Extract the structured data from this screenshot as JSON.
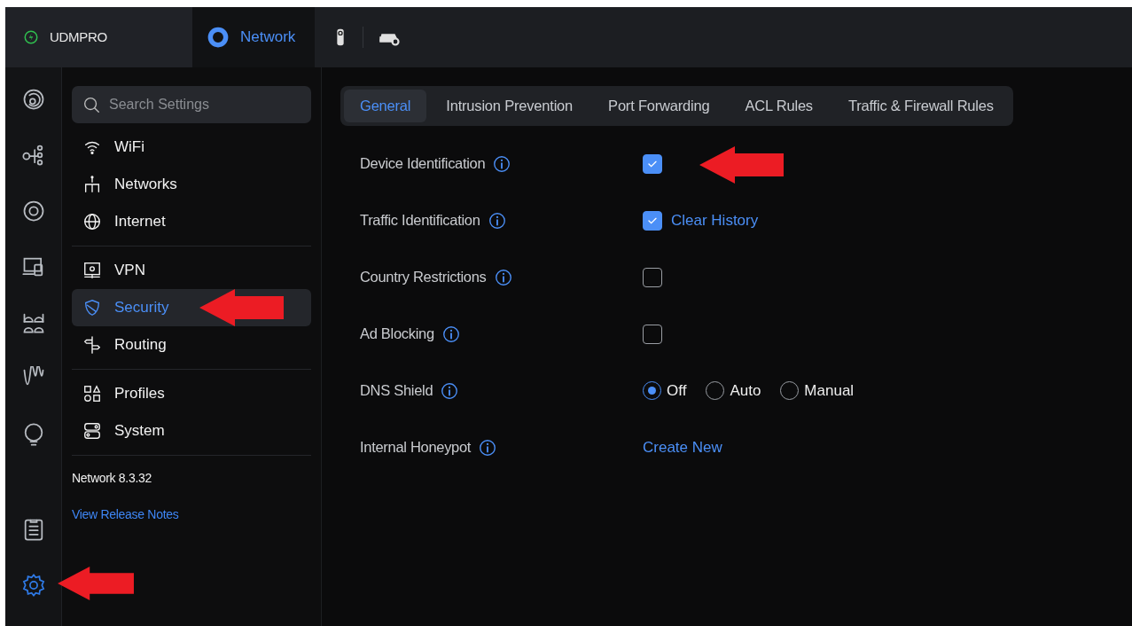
{
  "top_bar": {
    "console": {
      "name": "UDMPRO"
    },
    "apps": [
      {
        "label": "Network",
        "selected": true
      }
    ]
  },
  "rail": [
    {
      "selected": false
    },
    {
      "selected": false
    },
    {
      "selected": false
    },
    {
      "selected": false
    },
    {
      "selected": false
    },
    {
      "selected": false
    },
    {
      "selected": false
    },
    {
      "selected": false
    },
    {
      "selected": true,
      "pointer_arrow": true
    }
  ],
  "settings_nav": {
    "search": {
      "placeholder": "Search Settings"
    },
    "groups": [
      {
        "items": [
          {
            "label": "WiFi",
            "selected": false
          },
          {
            "label": "Networks",
            "selected": false
          },
          {
            "label": "Internet",
            "selected": false
          }
        ]
      },
      {
        "items": [
          {
            "label": "VPN",
            "selected": false
          },
          {
            "label": "Security",
            "selected": true,
            "pointer_arrow": true
          },
          {
            "label": "Routing",
            "selected": false
          }
        ]
      },
      {
        "items": [
          {
            "label": "Profiles",
            "selected": false
          },
          {
            "label": "System",
            "selected": false
          }
        ]
      }
    ],
    "version": "Network 8.3.32",
    "release_notes": "View Release Notes"
  },
  "tabs": [
    {
      "label": "General",
      "selected": true
    },
    {
      "label": "Intrusion Prevention",
      "selected": false
    },
    {
      "label": "Port Forwarding",
      "selected": false
    },
    {
      "label": "ACL Rules",
      "selected": false
    },
    {
      "label": "Traffic & Firewall Rules",
      "selected": false
    }
  ],
  "settings": [
    {
      "label": "Device Identification",
      "kind": "checkbox",
      "checked": true,
      "pointer_arrow": true
    },
    {
      "label": "Traffic Identification",
      "kind": "checkbox",
      "checked": true,
      "link": "Clear History"
    },
    {
      "label": "Country Restrictions",
      "kind": "checkbox",
      "checked": false
    },
    {
      "label": "Ad Blocking",
      "kind": "checkbox",
      "checked": false
    },
    {
      "label": "DNS Shield",
      "kind": "radio",
      "options": [
        {
          "label": "Off",
          "selected": true
        },
        {
          "label": "Auto",
          "selected": false
        },
        {
          "label": "Manual",
          "selected": false
        }
      ]
    },
    {
      "label": "Internal Honeypot",
      "kind": "link",
      "link": "Create New"
    }
  ]
}
